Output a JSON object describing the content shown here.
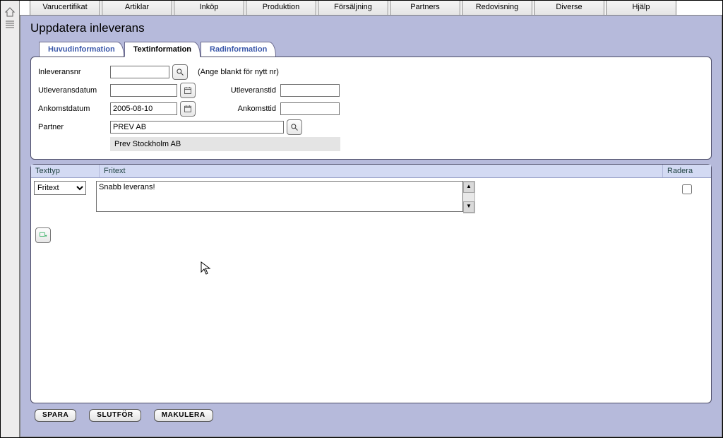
{
  "menu": {
    "items": [
      "Varucertifikat",
      "Artiklar",
      "Inköp",
      "Produktion",
      "Försäljning",
      "Partners",
      "Redovisning",
      "Diverse",
      "Hjälp"
    ]
  },
  "page": {
    "title": "Uppdatera inleverans"
  },
  "tabs": {
    "a": "Huvudinformation",
    "b": "Textinformation",
    "c": "Radinformation"
  },
  "form": {
    "inlev_label": "Inleveransnr",
    "inlev_value": "",
    "inlev_hint": "(Ange blankt för nytt nr)",
    "utdate_label": "Utleveransdatum",
    "utdate_value": "",
    "uttid_label": "Utleveranstid",
    "uttid_value": "",
    "ankdate_label": "Ankomstdatum",
    "ankdate_value": "2005-08-10",
    "anktid_label": "Ankomsttid",
    "anktid_value": "",
    "partner_label": "Partner",
    "partner_value": "PREV AB",
    "partner_name": "Prev Stockholm AB"
  },
  "grid": {
    "col_type": "Texttyp",
    "col_text": "Fritext",
    "col_del": "Radera",
    "type_option": "Fritext",
    "free_text": "Snabb leverans!"
  },
  "footer": {
    "save": "SPARA",
    "finish": "SLUTFÖR",
    "void": "MAKULERA"
  }
}
